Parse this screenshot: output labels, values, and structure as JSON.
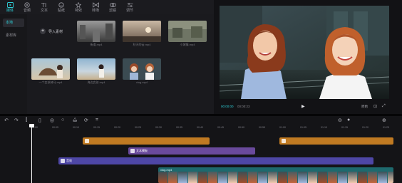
{
  "tabs": [
    {
      "label": "媒体",
      "icon": "media-icon",
      "active": true
    },
    {
      "label": "音频",
      "icon": "audio-icon",
      "active": false
    },
    {
      "label": "文本",
      "icon": "text-icon",
      "active": false
    },
    {
      "label": "贴纸",
      "icon": "sticker-icon",
      "active": false
    },
    {
      "label": "特效",
      "icon": "effects-icon",
      "active": false
    },
    {
      "label": "转场",
      "icon": "transition-icon",
      "active": false
    },
    {
      "label": "滤镜",
      "icon": "filter-icon",
      "active": false
    },
    {
      "label": "调节",
      "icon": "adjust-icon",
      "active": false
    }
  ],
  "sidenav": [
    "本地",
    "素材库"
  ],
  "media": {
    "import_label": "导入素材",
    "clips": [
      {
        "caption": "街道.mp4"
      },
      {
        "caption": "秋天的云.mp4"
      },
      {
        "caption": "小城镇.mp4"
      },
      {
        "caption": "一个女孩骑马.mp4"
      },
      {
        "caption": "海边女孩.mp4"
      },
      {
        "caption": "vlog.mp4"
      }
    ]
  },
  "player": {
    "current_time": "00:00:00",
    "total_time": "00:00:23",
    "ratio_label": "原始"
  },
  "timeline": {
    "ruler": [
      "00:00",
      "00:05",
      "00:10",
      "00:15",
      "00:20",
      "00:25",
      "00:30",
      "00:35",
      "00:40",
      "00:45",
      "00:50",
      "00:55",
      "01:00",
      "01:05",
      "01:10",
      "01:15",
      "01:20",
      "01:25",
      "01:30"
    ],
    "tracks": {
      "text_clip": "文本模板",
      "effect_clip": "音效",
      "video_clip": "vlog.mp4"
    }
  },
  "colors": {
    "accent": "#2fd0d8",
    "orange_track": "#c07a22",
    "purple_track": "#6a4a9c",
    "indigo_track": "#4e47a6",
    "video_track": "#1e6a6e"
  }
}
